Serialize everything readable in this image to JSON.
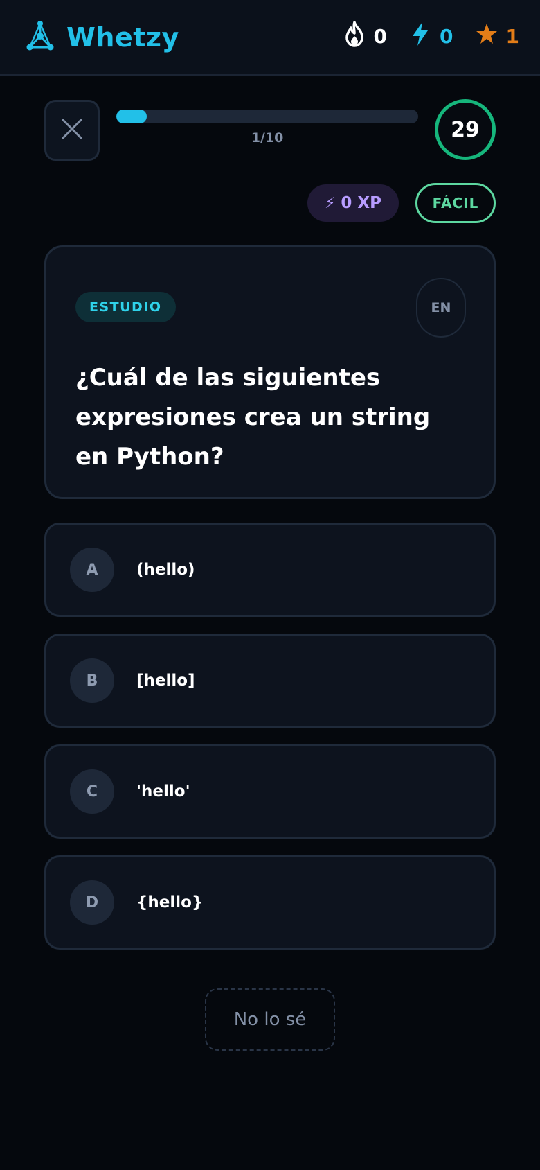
{
  "header": {
    "app_name": "Whetzy",
    "logo_icon": "molecule-logo-icon",
    "stats": {
      "streak": {
        "icon": "flame-icon",
        "value": "0"
      },
      "energy": {
        "icon": "bolt-icon",
        "value": "0"
      },
      "stars": {
        "icon": "star-icon",
        "value": "1"
      }
    }
  },
  "quiz": {
    "close_icon": "close-icon",
    "progress": {
      "current": 1,
      "total": 10,
      "label": "1/10",
      "fraction": 0.1
    },
    "timer": "29",
    "xp": {
      "icon": "bolt-icon",
      "label": "0 XP"
    },
    "difficulty": "FÁCIL"
  },
  "question": {
    "category": "ESTUDIO",
    "language_toggle": "EN",
    "text": "¿Cuál de las siguientes expresiones crea un string en Python?"
  },
  "options": [
    {
      "letter": "A",
      "text": "(hello)"
    },
    {
      "letter": "B",
      "text": "[hello]"
    },
    {
      "letter": "C",
      "text": "'hello'"
    },
    {
      "letter": "D",
      "text": "{hello}"
    }
  ],
  "skip_label": "No lo sé",
  "colors": {
    "accent": "#22c0e8",
    "timer_ring": "#16b67c",
    "difficulty": "#5dd7a0",
    "xp": "#b79cff",
    "star": "#e37d18"
  }
}
